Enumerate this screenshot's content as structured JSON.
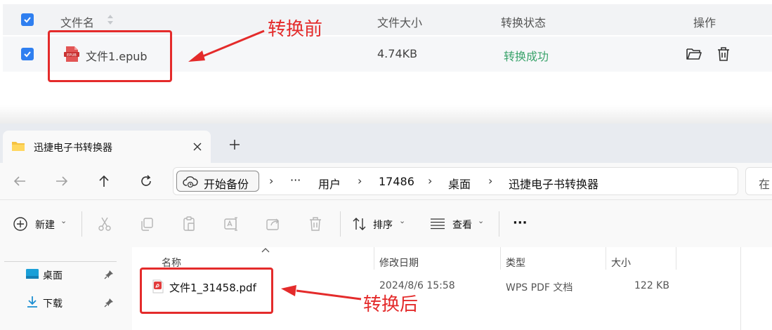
{
  "converter": {
    "header": {
      "name": "文件名",
      "size": "文件大小",
      "status": "转换状态",
      "actions": "操作"
    },
    "row": {
      "file_name": "文件1.epub",
      "size": "4.74KB",
      "status": "转换成功",
      "icon_text": "EPUB"
    },
    "annotation_before": "转换前"
  },
  "explorer": {
    "tab_title": "迅捷电子书转换器",
    "address": {
      "backup_label": "开始备份",
      "ellipsis": "···",
      "crumbs": [
        "用户",
        "17486",
        "桌面",
        "迅捷电子书转换器"
      ],
      "search_partial": "在"
    },
    "toolbar": {
      "new_label": "新建",
      "sort_label": "排序",
      "view_label": "查看",
      "more_label": "···"
    },
    "nav": {
      "items": [
        "桌面",
        "下载"
      ]
    },
    "columns": {
      "name": "名称",
      "modified": "修改日期",
      "type": "类型",
      "size": "大小"
    },
    "file": {
      "name": "文件1_31458.pdf",
      "modified": "2024/8/6 15:58",
      "type": "WPS PDF 文档",
      "size": "122 KB"
    },
    "annotation_after": "转换后"
  },
  "colors": {
    "accent": "#2f7ff0",
    "success": "#3aa36b",
    "annotation_red": "#e42b2b"
  }
}
